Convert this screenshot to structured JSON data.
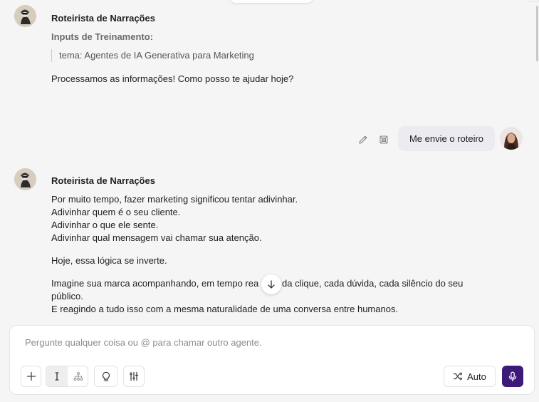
{
  "colors": {
    "background": "#f5f5f5",
    "user_bubble": "#ebebf0",
    "mic_accent": "#3d1a7a",
    "muted_text": "#6b6b6b"
  },
  "messages": {
    "first": {
      "agent_name": "Roteirista de Narrações",
      "inputs_label": "Inputs de Treinamento:",
      "input_item": "tema: Agentes de IA Generativa para Marketing",
      "body": "Processamos as informações! Como posso te ajudar hoje?"
    },
    "user": {
      "text": "Me envie o roteiro",
      "actions": [
        "pencil-icon",
        "copy-icon"
      ]
    },
    "second": {
      "agent_name": "Roteirista de Narrações",
      "paragraphs": {
        "p1": {
          "l1": "Por muito tempo, fazer marketing significou tentar adivinhar.",
          "l2": "Adivinhar quem é o seu cliente.",
          "l3": "Adivinhar o que ele sente.",
          "l4": "Adivinhar qual mensagem vai chamar sua atenção."
        },
        "p2": "Hoje, essa lógica se inverte.",
        "p3": {
          "l1a": "Imagine sua marca acompanhando, em tempo rea",
          "l1b": "da clique, cada dúvida, cada silêncio do seu",
          "l2": "público.",
          "l3": "E reagindo a tudo isso com a mesma naturalidade de uma conversa entre humanos."
        }
      }
    }
  },
  "composer": {
    "placeholder": "Pergunte qualquer coisa ou @ para chamar outro agente.",
    "value": "",
    "auto_label": "Auto",
    "icons": [
      "plus-icon",
      "cursor-icon",
      "hierarchy-icon",
      "lightbulb-icon",
      "sliders-icon",
      "shuffle-icon",
      "microphone-icon"
    ]
  }
}
